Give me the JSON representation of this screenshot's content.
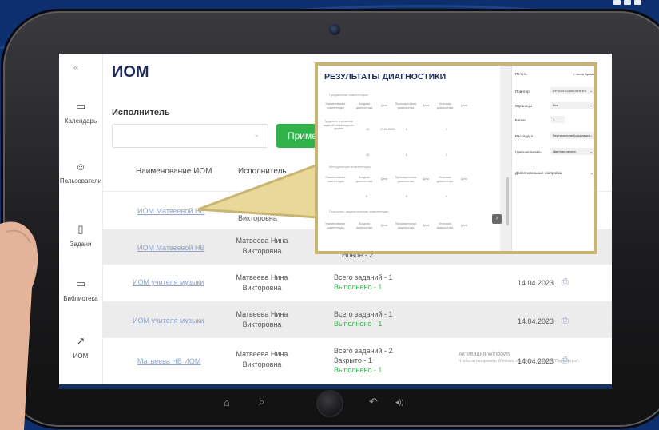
{
  "app": {
    "title": "ИОМ",
    "collapse_icon": "double-chevron-left"
  },
  "sidebar": {
    "items": [
      {
        "label": "Календарь",
        "icon": "calendar-icon",
        "glyph": "▭"
      },
      {
        "label": "Пользователи",
        "icon": "users-icon",
        "glyph": "☺"
      },
      {
        "label": "Задачи",
        "icon": "clipboard-icon",
        "glyph": "▯"
      },
      {
        "label": "Библиотека",
        "icon": "book-icon",
        "glyph": "▭"
      },
      {
        "label": "ИОМ",
        "icon": "trend-icon",
        "glyph": "↗"
      }
    ]
  },
  "filter": {
    "label": "Исполнитель",
    "select_value": "",
    "apply_label": "Приме"
  },
  "table": {
    "headers": [
      "Наименование ИОМ",
      "Исполнитель"
    ],
    "rows": [
      {
        "name": "ИОМ Матвеевой НВ",
        "executor": "Викторовна",
        "tasks": [],
        "date": ""
      },
      {
        "name": "ИОМ Матвеевой НВ",
        "executor": "Матвеева Нина Викторовна",
        "tasks": [
          "Новое - 2"
        ],
        "date": ""
      },
      {
        "name": "ИОМ учителя музыки",
        "executor": "Матвеева Нина Викторовна",
        "tasks": [
          "Всего заданий - 1",
          "Выполнено - 1"
        ],
        "date": "14.04.2023"
      },
      {
        "name": "ИОМ учителя музыки",
        "executor": "Матвеева Нина Викторовна",
        "tasks": [
          "Всего заданий - 1",
          "Выполнено - 1"
        ],
        "date": "14.04.2023"
      },
      {
        "name": "Матвеева НВ ИОМ",
        "executor": "Матвеева Нина Викторовна",
        "tasks": [
          "Всего заданий - 2",
          "Закрыто - 1",
          "Выполнено - 1"
        ],
        "date": "14.04.2023"
      }
    ]
  },
  "activation": {
    "title": "Активация Windows",
    "subtitle": "Чтобы активировать Windows, перейдите в раздел \"Параметры\"."
  },
  "print_dialog": {
    "doc_title": "РЕЗУЛЬТАТЫ ДИАГНОСТИКИ",
    "sections": [
      "Предметные компетенции",
      "Методические компетенции",
      "Психолого-педагогические компетенции"
    ],
    "col_headers": [
      "Наименование компетенции",
      "Входная диагностика",
      "Дата",
      "Промежуточная диагностика",
      "Дата",
      "Итоговая диагностика",
      "Дата"
    ],
    "row1_label": "Трудности в решении заданий олимпиадного уровня",
    "row1_values": [
      "10",
      "17.04.2023",
      "0",
      "0"
    ],
    "row2_values": [
      "10",
      "0",
      "0"
    ],
    "row3_values": [
      "0",
      "0",
      "0"
    ],
    "settings": {
      "title": "Печать",
      "pages": "3 листа бумаги",
      "fields": [
        {
          "label": "Принтер",
          "value": "EPSON L3150 SERIES"
        },
        {
          "label": "Страницы",
          "value": "Все"
        },
        {
          "label": "Копии",
          "value": "1"
        },
        {
          "label": "Раскладка",
          "value": "Вертикальная раскладка"
        },
        {
          "label": "Цветная печать",
          "value": "Цветная печать"
        }
      ],
      "more": "Дополнительные настройки"
    }
  },
  "tablet_nav": {
    "icons": [
      "home-icon",
      "search-icon",
      "back-icon",
      "volume-icon"
    ],
    "glyphs": [
      "⌂",
      "⌕",
      "↶",
      "◂))"
    ]
  },
  "colors": {
    "background": "#0d2f6e",
    "accent_green": "#2fb34a",
    "title_navy": "#1d2a5a",
    "link": "#8fa4c8",
    "callout_border": "#c9b571"
  }
}
